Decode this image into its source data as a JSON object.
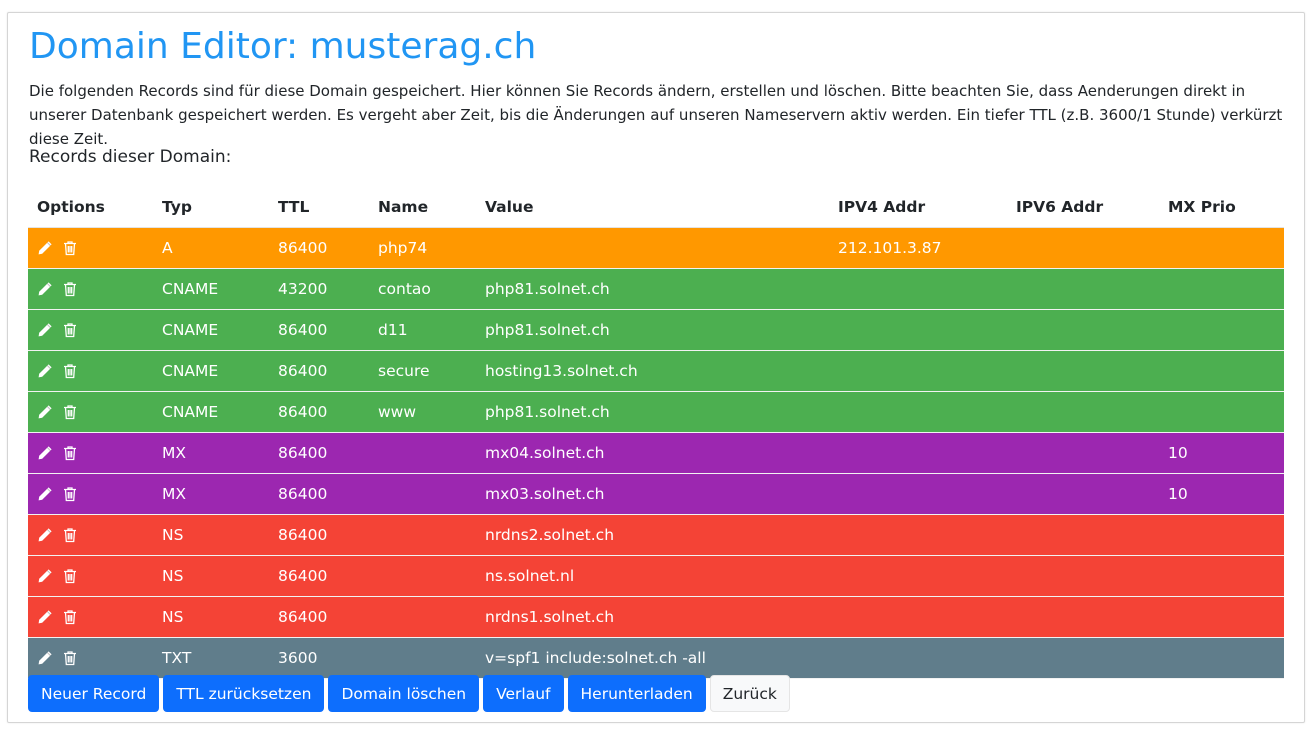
{
  "page": {
    "title": "Domain Editor: musterag.ch",
    "intro": "Die folgenden Records sind für diese Domain gespeichert. Hier können Sie Records ändern, erstellen und löschen. Bitte beachten Sie, dass Aenderungen direkt in unserer Datenbank gespeichert werden. Es vergeht aber Zeit, bis die Änderungen auf unseren Nameservern aktiv werden. Ein tiefer TTL (z.B. 3600/1 Stunde) verkürzt diese Zeit.",
    "records_title": "Records dieser Domain:"
  },
  "table": {
    "headers": [
      "Options",
      "Typ",
      "TTL",
      "Name",
      "Value",
      "IPV4 Addr",
      "IPV6 Addr",
      "MX Prio"
    ],
    "rows": [
      {
        "type": "A",
        "ttl": "86400",
        "name": "php74",
        "value": "",
        "ipv4": "212.101.3.87",
        "ipv6": "",
        "mx": "",
        "color": "#ff9800"
      },
      {
        "type": "CNAME",
        "ttl": "43200",
        "name": "contao",
        "value": "php81.solnet.ch",
        "ipv4": "",
        "ipv6": "",
        "mx": "",
        "color": "#4caf50"
      },
      {
        "type": "CNAME",
        "ttl": "86400",
        "name": "d11",
        "value": "php81.solnet.ch",
        "ipv4": "",
        "ipv6": "",
        "mx": "",
        "color": "#4caf50"
      },
      {
        "type": "CNAME",
        "ttl": "86400",
        "name": "secure",
        "value": "hosting13.solnet.ch",
        "ipv4": "",
        "ipv6": "",
        "mx": "",
        "color": "#4caf50"
      },
      {
        "type": "CNAME",
        "ttl": "86400",
        "name": "www",
        "value": "php81.solnet.ch",
        "ipv4": "",
        "ipv6": "",
        "mx": "",
        "color": "#4caf50"
      },
      {
        "type": "MX",
        "ttl": "86400",
        "name": "",
        "value": "mx04.solnet.ch",
        "ipv4": "",
        "ipv6": "",
        "mx": "10",
        "color": "#9c27b0"
      },
      {
        "type": "MX",
        "ttl": "86400",
        "name": "",
        "value": "mx03.solnet.ch",
        "ipv4": "",
        "ipv6": "",
        "mx": "10",
        "color": "#9c27b0"
      },
      {
        "type": "NS",
        "ttl": "86400",
        "name": "",
        "value": "nrdns2.solnet.ch",
        "ipv4": "",
        "ipv6": "",
        "mx": "",
        "color": "#f44336"
      },
      {
        "type": "NS",
        "ttl": "86400",
        "name": "",
        "value": "ns.solnet.nl",
        "ipv4": "",
        "ipv6": "",
        "mx": "",
        "color": "#f44336"
      },
      {
        "type": "NS",
        "ttl": "86400",
        "name": "",
        "value": "nrdns1.solnet.ch",
        "ipv4": "",
        "ipv6": "",
        "mx": "",
        "color": "#f44336"
      },
      {
        "type": "TXT",
        "ttl": "3600",
        "name": "",
        "value": "v=spf1 include:solnet.ch -all",
        "ipv4": "",
        "ipv6": "",
        "mx": "",
        "color": "#607d8b"
      }
    ],
    "row_icons": [
      "pencil-icon",
      "trash-icon"
    ]
  },
  "buttons": {
    "new_record": "Neuer Record",
    "reset_ttl": "TTL zurücksetzen",
    "delete_domain": "Domain löschen",
    "history": "Verlauf",
    "download": "Herunterladen",
    "back": "Zurück"
  },
  "colors": {
    "title": "#2196f3",
    "primary_button": "#0d6efd",
    "type_A": "#ff9800",
    "type_CNAME": "#4caf50",
    "type_MX": "#9c27b0",
    "type_NS": "#f44336",
    "type_TXT": "#607d8b"
  }
}
